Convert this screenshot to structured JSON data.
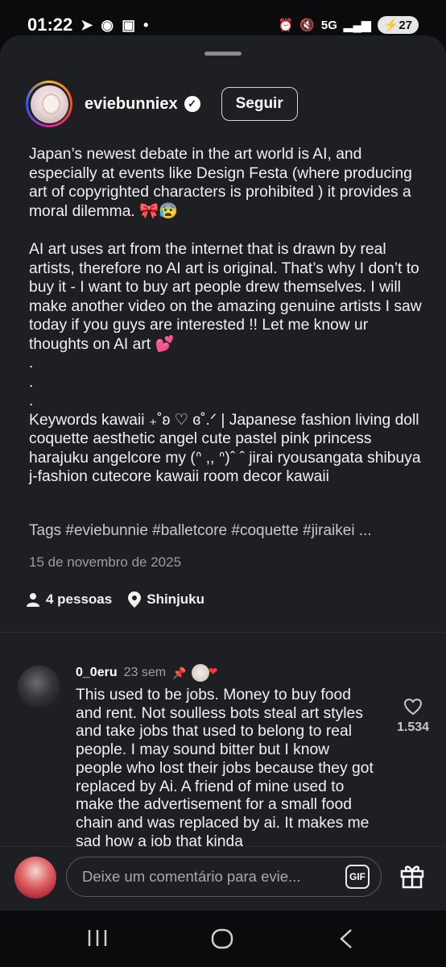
{
  "status_bar": {
    "time": "01:22",
    "network": "5G",
    "battery": "27"
  },
  "post": {
    "username": "eviebunniex",
    "follow_label": "Seguir",
    "caption_paragraphs": [
      "Japan’s newest debate in the art world is AI, and especially at events like Design Festa (where producing art of copyrighted characters is prohibited ) it provides a moral dilemma. 🎀😰",
      "AI art uses art from the internet that is drawn by real artists, therefore no AI art is original. That’s why I don’t to buy it - I want to buy art people drew themselves. I will make another video on the amazing genuine artists I saw today if you guys are interested !! Let me know ur thoughts on AI art 💕",
      ".",
      ".",
      ".",
      "Keywords kawaii ₊˚ʚ ♡ ɞ˚.ᐟ | Japanese fashion living doll coquette aesthetic angel cute pastel pink princess harajuku angelcore my (ᐢ ,, ᐢ)ˆ ˆ jirai ryousangata shibuya j-fashion cutecore kawaii room decor kawaii"
    ],
    "tags": "Tags #eviebunnie #balletcore #coquette #jiraikei ...",
    "date": "15 de novembro de 2025",
    "people": "4 pessoas",
    "location": "Shinjuku"
  },
  "comment": {
    "username": "0_0eru",
    "time": "23 sem",
    "text": "This used to be jobs. Money to buy food and rent. Not soulless bots steal art styles and take jobs that used to belong to real people. I may sound bitter but I know people who lost their jobs because they got replaced by Ai. A friend of mine used to make the advertisement for a small food chain and was replaced by ai. It makes me sad how a job that kinda",
    "likes": "1.534"
  },
  "composer": {
    "placeholder": "Deixe um comentário para evie...",
    "gif_label": "GIF"
  }
}
